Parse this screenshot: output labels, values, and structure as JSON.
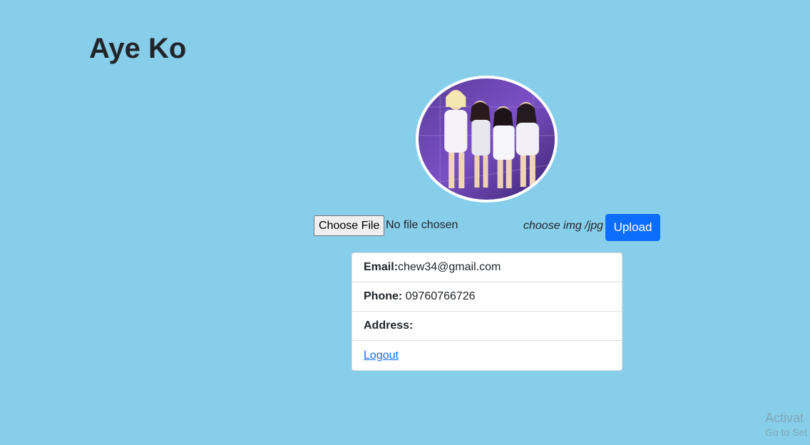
{
  "header": {
    "title": "Aye Ko"
  },
  "profile": {
    "photo_icon": "profile-photo"
  },
  "upload": {
    "choose_file_label": "Choose File",
    "file_status": "No file chosen",
    "hint": "choose img /jpg",
    "upload_label": "Upload"
  },
  "info": {
    "email_label": "Email:",
    "email_value": "chew34@gmail.com",
    "phone_label": "Phone:",
    "phone_value": "09760766726",
    "address_label": "Address:",
    "address_value": "",
    "logout_label": "Logout"
  },
  "watermark": {
    "line1": "Activat",
    "line2": "Go to Set"
  },
  "colors": {
    "background": "#87ceeb",
    "primary": "#0d6efd"
  }
}
